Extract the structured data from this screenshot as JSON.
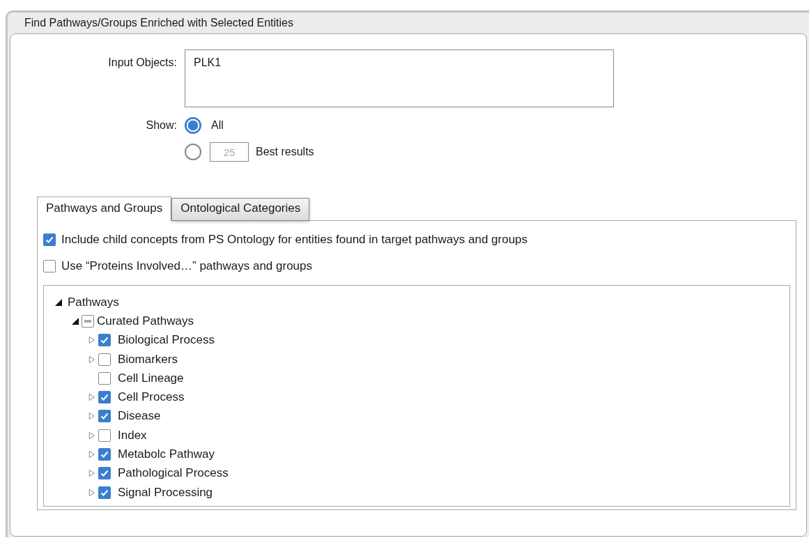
{
  "window": {
    "title": "Find Pathways/Groups Enriched with Selected Entities"
  },
  "input_objects": {
    "label": "Input Objects:",
    "value": "PLK1"
  },
  "show": {
    "label": "Show:",
    "options": [
      {
        "kind": "plain",
        "label": "All",
        "selected": true
      },
      {
        "kind": "count",
        "count": "25",
        "label": "Best results",
        "selected": false
      }
    ]
  },
  "tabs": [
    {
      "label": "Pathways and Groups",
      "selected": true
    },
    {
      "label": "Ontological Categories",
      "selected": false
    }
  ],
  "options": [
    {
      "label": "Include child concepts from PS Ontology for entities found in target pathways and groups",
      "checked": true
    },
    {
      "label": "Use “Proteins Involved…” pathways and groups",
      "checked": false
    }
  ],
  "tree": [
    {
      "label": "Pathways",
      "expanded": true,
      "children": [
        {
          "label": "Curated Pathways",
          "indeterminate": true,
          "expanded": true,
          "children": [
            {
              "label": "Biological Process",
              "checked": true,
              "expanded": false
            },
            {
              "label": "Biomarkers",
              "checked": false,
              "expanded": false
            },
            {
              "label": "Cell Lineage",
              "checked": false
            },
            {
              "label": "Cell Process",
              "checked": true,
              "expanded": false
            },
            {
              "label": "Disease",
              "checked": true,
              "expanded": false
            },
            {
              "label": "Index",
              "checked": false,
              "expanded": false
            },
            {
              "label": "Metabolc Pathway",
              "checked": true,
              "expanded": false
            },
            {
              "label": "Pathological Process",
              "checked": true,
              "expanded": false
            },
            {
              "label": "Signal Processing",
              "checked": true,
              "expanded": false
            }
          ]
        }
      ]
    }
  ]
}
